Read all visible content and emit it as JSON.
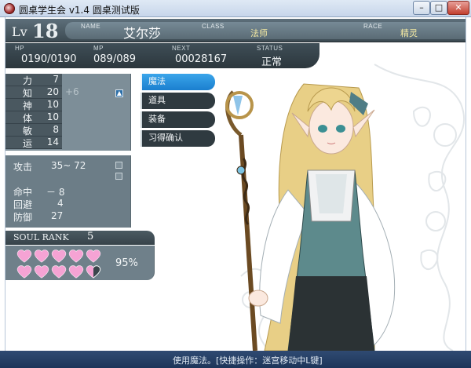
{
  "window": {
    "title": "圆桌学生会 v1.4 圆桌测试版",
    "min_glyph": "–",
    "max_glyph": "□",
    "close_glyph": "✕"
  },
  "character": {
    "lv_label": "Lv",
    "level": "18",
    "name_label": "NAME",
    "name": "艾尔莎",
    "class_label": "CLASS",
    "class": "法师",
    "race_label": "RACE",
    "race": "精灵"
  },
  "vitals": {
    "hp_label": "HP",
    "hp": "0190/0190",
    "mp_label": "MP",
    "mp": "089/089",
    "next_label": "NEXT",
    "next": "00028167",
    "status_label": "STATUS",
    "status": "正常"
  },
  "stats": [
    {
      "name": "力",
      "value": "7",
      "bonus": ""
    },
    {
      "name": "知",
      "value": "20",
      "bonus": "+6"
    },
    {
      "name": "神",
      "value": "10",
      "bonus": ""
    },
    {
      "name": "体",
      "value": "10",
      "bonus": ""
    },
    {
      "name": "敏",
      "value": "8",
      "bonus": ""
    },
    {
      "name": "运",
      "value": "14",
      "bonus": ""
    }
  ],
  "combat": {
    "attack_label": "攻击",
    "attack_value": "35~ 72",
    "hit_label": "命中",
    "hit_value": "－ 8",
    "evade_label": "回避",
    "evade_value": "4",
    "defense_label": "防御",
    "defense_value": "27"
  },
  "soul": {
    "label": "SOUL RANK",
    "rank": "5",
    "percent_text": "95%",
    "hearts_total": 10,
    "hearts_full": 9.5
  },
  "menu": [
    {
      "label": "魔法",
      "active": true
    },
    {
      "label": "道具",
      "active": false
    },
    {
      "label": "装备",
      "active": false
    },
    {
      "label": "习得确认",
      "active": false
    }
  ],
  "footer": {
    "hint": "使用魔法。[快捷操作：迷宫移动中L键]"
  },
  "colors": {
    "heart_pink": "#f5a3d4",
    "menu_active": "#2a93e0",
    "header_dark": "#3c4a52",
    "footer_blue": "#1d3559"
  }
}
